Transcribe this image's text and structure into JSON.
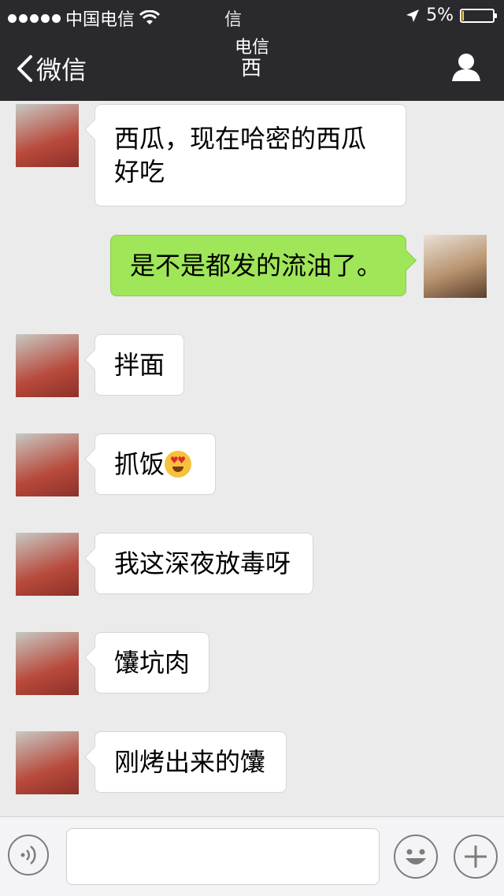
{
  "status_bar": {
    "carrier": "中国电信",
    "center_text": "信",
    "battery_percent": "5%",
    "battery_level": 0.05,
    "icons": [
      "signal-dots-icon",
      "wifi-icon",
      "location-arrow-icon",
      "battery-icon"
    ]
  },
  "nav": {
    "back_label": "微信",
    "title_line1": "电信",
    "title_line2": "西",
    "icons": [
      "chevron-left-icon",
      "profile-icon"
    ]
  },
  "messages": [
    {
      "side": "in",
      "text": "西瓜，现在哈密的西瓜好吃"
    },
    {
      "side": "out",
      "text": "是不是都发的流油了。"
    },
    {
      "side": "in",
      "text": "拌面"
    },
    {
      "side": "in",
      "text": "抓饭",
      "emoji": "star-struck-emoji"
    },
    {
      "side": "in",
      "text": "我这深夜放毒呀"
    },
    {
      "side": "in",
      "text": "馕坑肉"
    },
    {
      "side": "in",
      "text": "刚烤出来的馕"
    }
  ],
  "input_bar": {
    "icons": [
      "voice-icon",
      "emoji-icon",
      "plus-icon"
    ]
  },
  "colors": {
    "header": "#2a2a2e",
    "chat_background": "#ebebeb",
    "outgoing_bubble": "#9fe658",
    "incoming_bubble": "#ffffff"
  }
}
